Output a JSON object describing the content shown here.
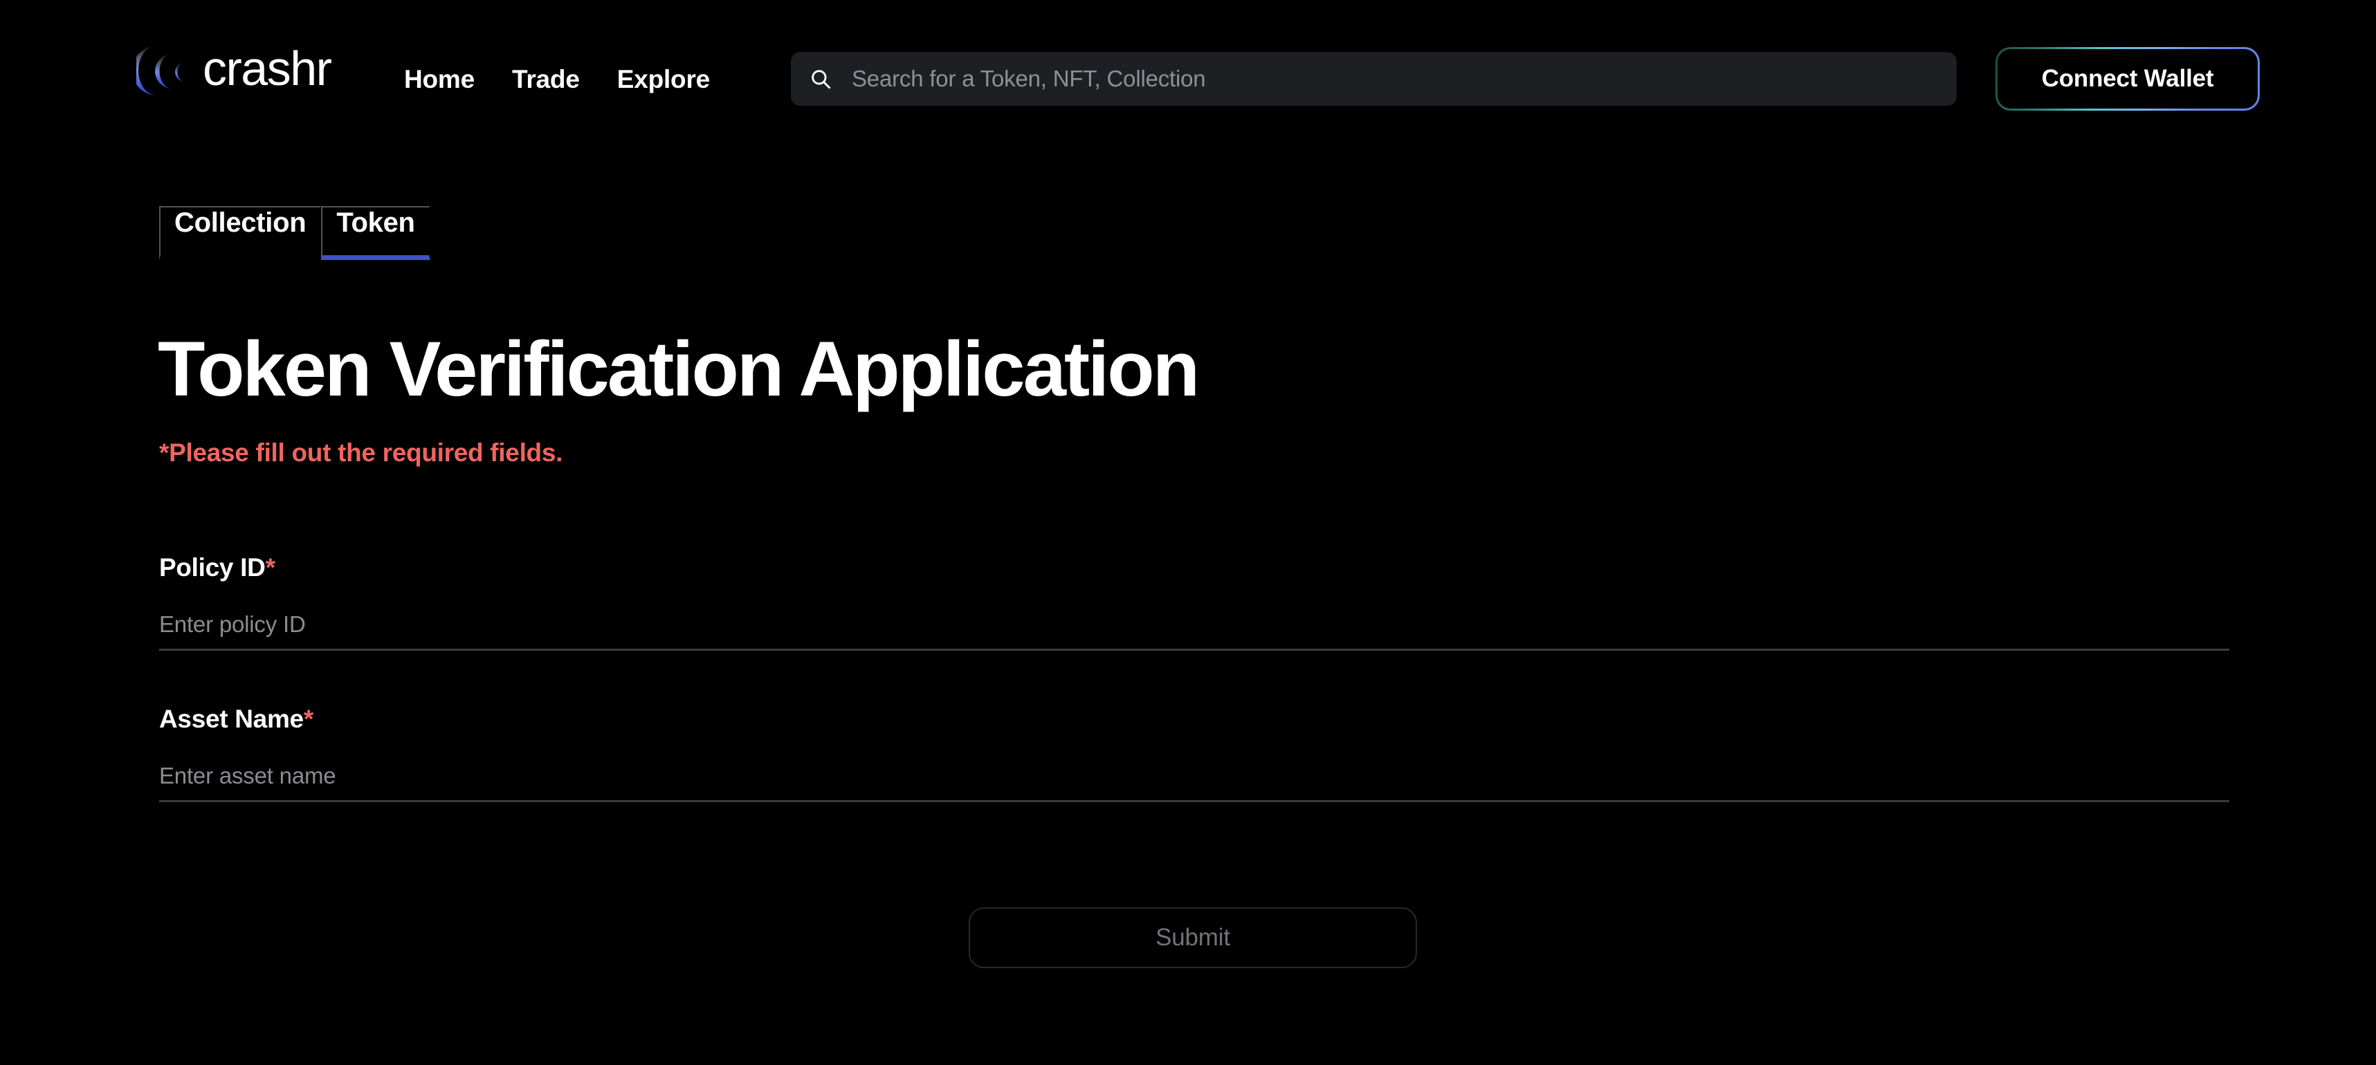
{
  "brand": {
    "name": "crashr",
    "logo_icon": "crashr-waves-logo"
  },
  "nav": {
    "items": [
      {
        "label": "Home"
      },
      {
        "label": "Trade"
      },
      {
        "label": "Explore"
      }
    ]
  },
  "search": {
    "placeholder": "Search for a Token, NFT, Collection",
    "value": "",
    "icon": "search-icon"
  },
  "wallet": {
    "label": "Connect Wallet",
    "border_gradient_start": "#1d4a46",
    "border_gradient_mid": "#53c7c6",
    "border_gradient_end": "#6a8ae8"
  },
  "tabs": {
    "items": [
      {
        "label": "Collection",
        "active": false
      },
      {
        "label": "Token",
        "active": true
      }
    ],
    "active_underline_color": "#3f51cc"
  },
  "main": {
    "title": "Token Verification Application",
    "required_note": "*Please fill out the required fields.",
    "required_color": "#f0655e"
  },
  "form": {
    "fields": [
      {
        "label": "Policy ID",
        "required_marker": "*",
        "placeholder": "Enter policy ID",
        "value": ""
      },
      {
        "label": "Asset Name",
        "required_marker": "*",
        "placeholder": "Enter asset name",
        "value": ""
      }
    ],
    "submit_label": "Submit",
    "submit_disabled": true
  },
  "theme": {
    "background": "#000000",
    "search_background": "#1d1f23",
    "input_underline": "#3a3c40",
    "accent_blue": "#3f51cc",
    "muted_text": "#8a8d92"
  }
}
